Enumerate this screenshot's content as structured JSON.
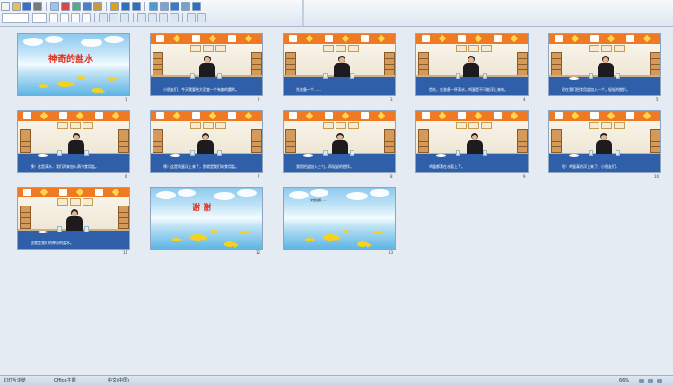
{
  "toolbar": {
    "buttons": [
      "new-icon",
      "open-icon",
      "save-icon",
      "print-icon",
      "preview-icon",
      "spelling-icon",
      "cut-icon",
      "copy-icon",
      "paste-icon",
      "format-painter-icon",
      "undo-icon",
      "redo-icon",
      "insert-chart-icon",
      "insert-table-icon",
      "hyperlink-icon",
      "zoom-icon",
      "help-icon"
    ],
    "format_buttons": [
      "bold-icon",
      "italic-icon",
      "underline-icon",
      "shadow-icon",
      "align-left-icon",
      "center-icon",
      "align-right-icon",
      "bullets-icon",
      "numbering-icon",
      "increase-font-icon",
      "decrease-font-icon",
      "design-icon",
      "new-slide-icon"
    ],
    "accent": "#1f5fb5"
  },
  "slides": [
    {
      "num": "1",
      "kind": "title",
      "title": "神奇的盐水",
      "title_color": "#e0301e"
    },
    {
      "num": "2",
      "kind": "photo",
      "caption": "小朋友们，今天我要给大家变一个有趣的魔术。"
    },
    {
      "num": "3",
      "kind": "photo",
      "caption": "先准备一个……"
    },
    {
      "num": "4",
      "kind": "photo",
      "caption": "首先，先准备一杯清水，鸡蛋是不可能浮上来的。"
    },
    {
      "num": "5",
      "kind": "photo",
      "caption": "现在我们把食用盐加入一个，轻轻的搅拌。"
    },
    {
      "num": "6",
      "kind": "photo",
      "caption": "咦！这是清水，我们再来加入两勺食用盐。"
    },
    {
      "num": "7",
      "kind": "photo",
      "caption": "咦！这是鸡蛋浮上来了，那就是我们的食用盐。"
    },
    {
      "num": "8",
      "kind": "photo",
      "caption": "我们把盐加入三勺，再轻轻的搅拌。"
    },
    {
      "num": "9",
      "kind": "photo",
      "caption": "鸡蛋都漂在水面上了。"
    },
    {
      "num": "10",
      "kind": "photo",
      "caption": "咦！鸡蛋真的浮上来了，小朋友们，"
    },
    {
      "num": "11",
      "kind": "photo",
      "caption": "这就是我们的神奇的盐水。"
    },
    {
      "num": "12",
      "kind": "title",
      "title": "谢 谢",
      "title_color": "#e0301e"
    },
    {
      "num": "13",
      "kind": "end",
      "text": "文档说明……"
    }
  ],
  "status": {
    "slide_info": "幻灯片浏览",
    "design": "Office主题",
    "language": "中文(中国)",
    "zoom": "66%"
  }
}
